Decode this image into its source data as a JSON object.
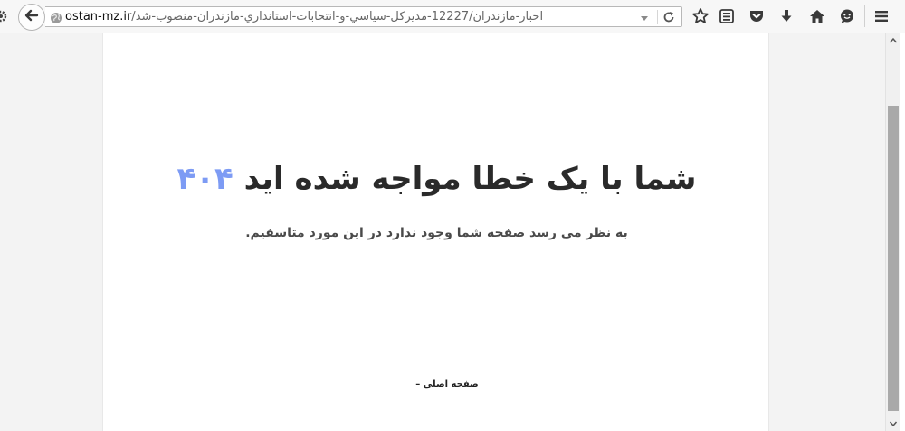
{
  "browser": {
    "url_domain": "ostan-mz.ir",
    "url_path": "/اخبار-مازندران/12227-مديرکل-سياسي-و-انتخابات-استانداري-مازندران-منصوب-شد",
    "icons": {
      "settings": "gear-icon",
      "back": "back-arrow-icon",
      "site_identity": "globe-icon",
      "url_dropdown": "chevron-down-icon",
      "reload": "reload-icon",
      "bookmark": "star-icon",
      "reader_view": "reading-list-icon",
      "pocket": "pocket-icon",
      "downloads": "download-icon",
      "home": "home-icon",
      "chat": "chat-icon",
      "menu": "hamburger-menu-icon"
    }
  },
  "page": {
    "headline": "شما با یک خطا مواجه شده اید",
    "error_code": "۴۰۴",
    "message": "به نظر می رسد صفحه شما وجود ندارد در این مورد متاسفیم.",
    "home_link": "صفحه اصلی –"
  },
  "colors": {
    "error_code": "#7d9bf4",
    "headline": "#2a2a2a",
    "page_background": "#ffffff",
    "outer_background": "#f3f3f3",
    "scroll_thumb": "#a9a9a9"
  }
}
